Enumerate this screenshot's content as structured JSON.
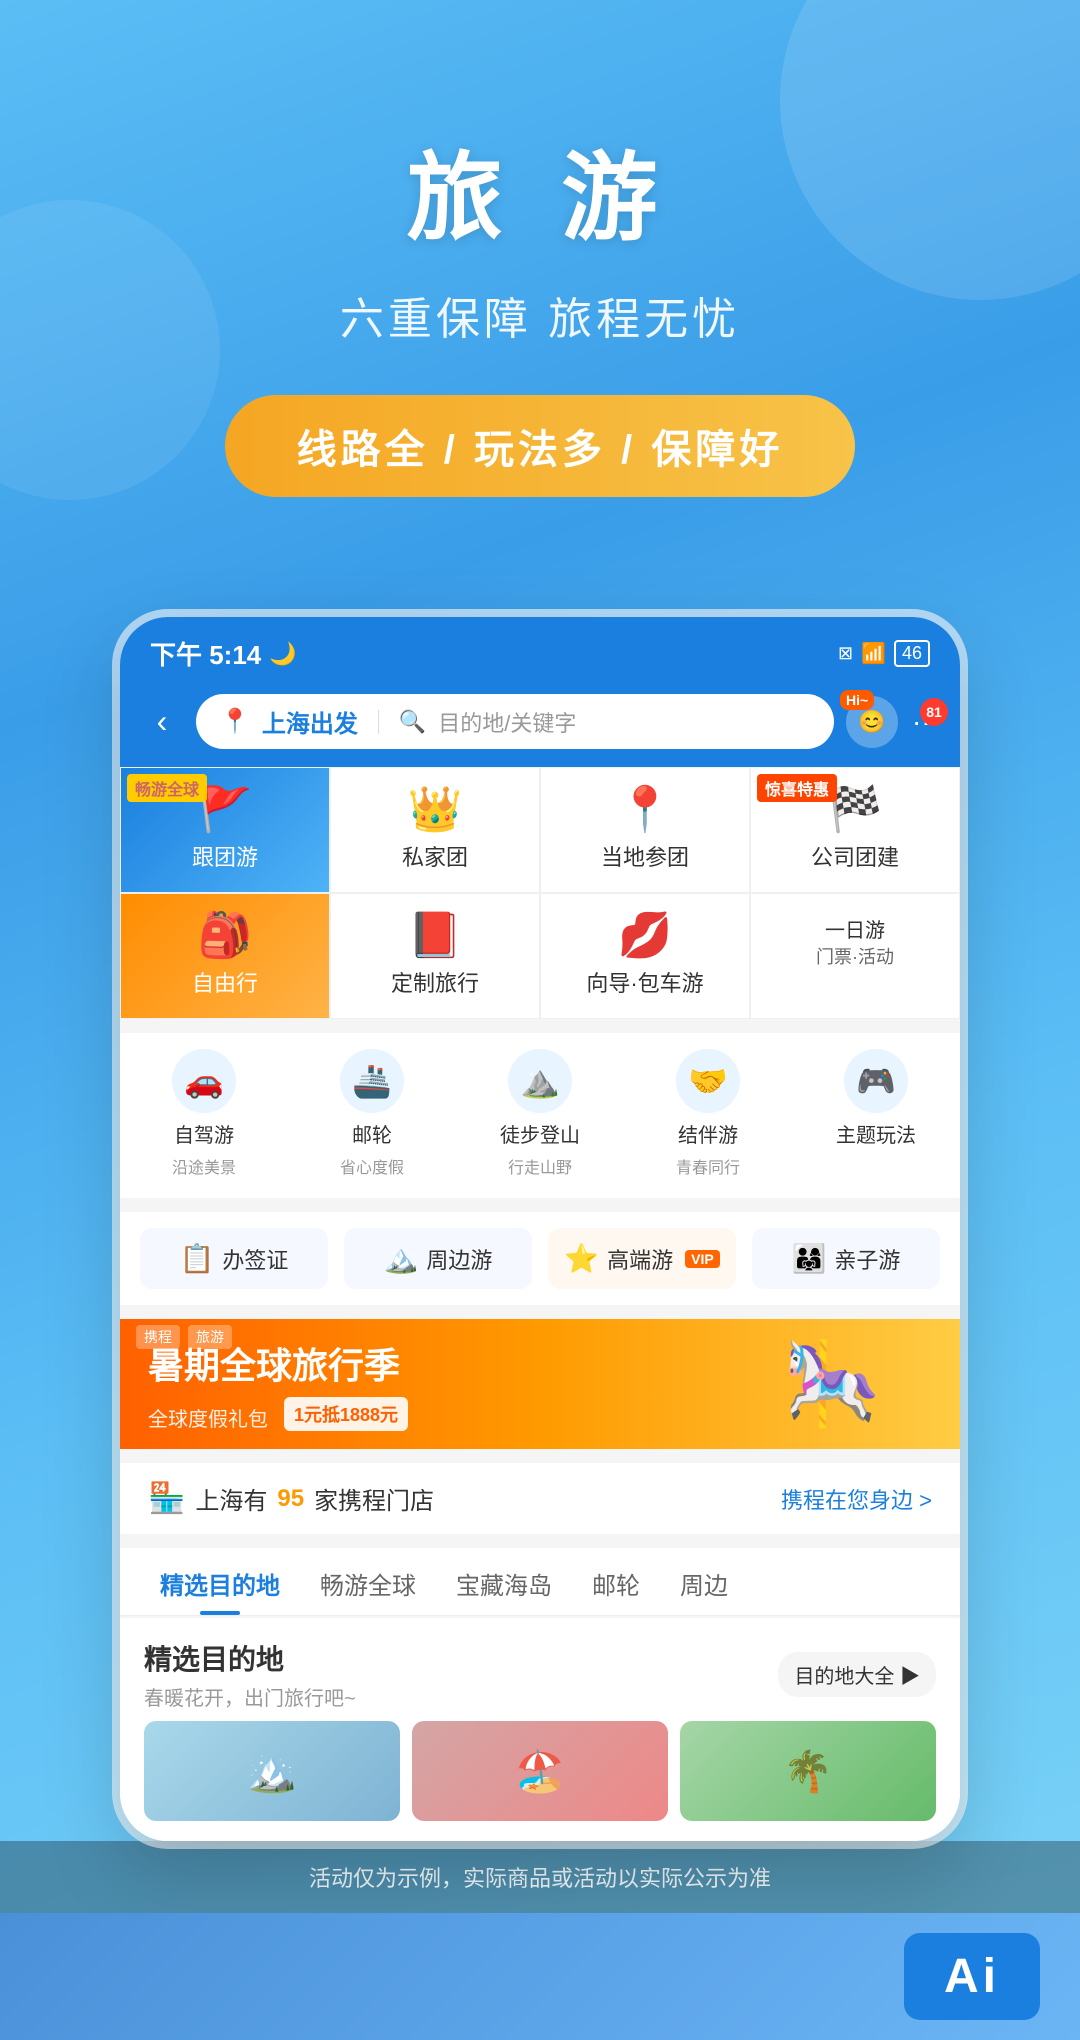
{
  "hero": {
    "title": "旅 游",
    "subtitle": "六重保障 旅程无忧",
    "badge": "线路全 / 玩法多 / 保障好"
  },
  "status_bar": {
    "time": "下午 5:14",
    "moon_icon": "🌙",
    "wifi": "WiFi",
    "battery": "46"
  },
  "nav": {
    "departure": "上海出发",
    "search_placeholder": "目的地/关键字",
    "hi_label": "Hi~",
    "notif_count": "81"
  },
  "categories": [
    {
      "id": "group_tour",
      "label": "跟团游",
      "icon": "🚩",
      "highlight": "blue",
      "badge": "畅游全球",
      "badge_type": "yellow"
    },
    {
      "id": "private_tour",
      "label": "私家团",
      "icon": "👑",
      "highlight": "none"
    },
    {
      "id": "local_tour",
      "label": "当地参团",
      "icon": "📍",
      "highlight": "none"
    },
    {
      "id": "corp_tour",
      "label": "公司团建",
      "icon": "🏁",
      "highlight": "none",
      "badge": "惊喜特惠",
      "badge_type": "red"
    },
    {
      "id": "free_tour",
      "label": "自由行",
      "icon": "🎒",
      "highlight": "orange"
    },
    {
      "id": "custom_tour",
      "label": "定制旅行",
      "icon": "📕",
      "highlight": "none"
    },
    {
      "id": "guide_tour",
      "label": "向导·包车游",
      "icon": "💋",
      "highlight": "none"
    },
    {
      "id": "day_tour",
      "label": "一日游\n门票·活动",
      "icon": "",
      "highlight": "none",
      "special": true
    }
  ],
  "services": [
    {
      "id": "self_drive",
      "title": "自驾游",
      "subtitle": "沿途美景",
      "icon": "🚗",
      "color": "#e8f4ff"
    },
    {
      "id": "cruise",
      "title": "邮轮",
      "subtitle": "省心度假",
      "icon": "🚢",
      "color": "#e8f4ff"
    },
    {
      "id": "hiking",
      "title": "徒步登山",
      "subtitle": "行走山野",
      "icon": "⛰️",
      "color": "#e8f4ff"
    },
    {
      "id": "companion",
      "title": "结伴游",
      "subtitle": "青春同行",
      "icon": "🤝",
      "color": "#e8f4ff"
    },
    {
      "id": "theme",
      "title": "主题玩法",
      "subtitle": "",
      "icon": "🎮",
      "color": "#e8f4ff"
    }
  ],
  "quick_tags": [
    {
      "id": "visa",
      "label": "办签证",
      "icon": "📋"
    },
    {
      "id": "nearby",
      "label": "周边游",
      "icon": "🏔️"
    },
    {
      "id": "luxury",
      "label": "高端游",
      "vip": true,
      "icon": "⭐"
    },
    {
      "id": "family",
      "label": "亲子游",
      "icon": "👨‍👩‍👧"
    }
  ],
  "banner": {
    "title": "暑期全球旅行季",
    "subtitle": "全球度假礼包",
    "cta": "1元抵1888元",
    "image_icon": "🎠"
  },
  "store_row": {
    "prefix": "上海有",
    "count": "95",
    "suffix": "家携程门店",
    "link": "携程在您身边 >"
  },
  "tabs": [
    {
      "id": "selected_dest",
      "label": "精选目的地",
      "active": true
    },
    {
      "id": "global",
      "label": "畅游全球"
    },
    {
      "id": "island",
      "label": "宝藏海岛"
    },
    {
      "id": "cruise_tab",
      "label": "邮轮"
    },
    {
      "id": "nearby_tab",
      "label": "周边"
    }
  ],
  "dest_section": {
    "title": "精选目的地",
    "subtitle": "春暖花开，出门旅行吧~",
    "all_btn": "目的地大全 ▶"
  },
  "disclaimer": "活动仅为示例，实际商品或活动以实际公示为准",
  "ai_label": "Ai"
}
